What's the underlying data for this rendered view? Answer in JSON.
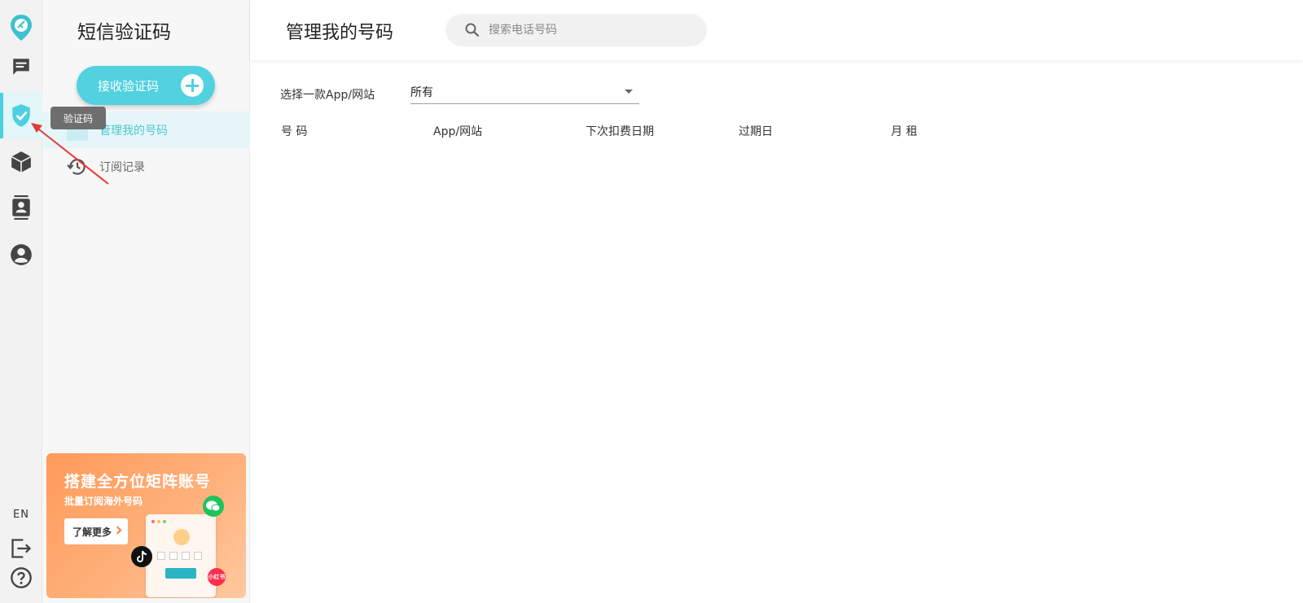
{
  "rail": {
    "items": [
      {
        "name": "logo",
        "icon": "logo-icon"
      },
      {
        "name": "messages",
        "icon": "chat-icon"
      },
      {
        "name": "verify",
        "icon": "shield-check-icon"
      },
      {
        "name": "packages",
        "icon": "box-icon"
      },
      {
        "name": "contacts",
        "icon": "contacts-icon"
      },
      {
        "name": "account",
        "icon": "user-icon"
      }
    ],
    "lang": "EN",
    "tooltip": "验证码",
    "accent": "#4dd0e1"
  },
  "sidebar": {
    "title": "短信验证码",
    "receive_button": "接收验证码",
    "items": [
      {
        "label": "管理我的号码",
        "active": true
      },
      {
        "label": "订阅记录",
        "active": false
      }
    ]
  },
  "promo": {
    "title": "搭建全方位矩阵账号",
    "subtitle": "批量订阅海外号码",
    "button": "了解更多",
    "badge": "小红书"
  },
  "header": {
    "title": "管理我的号码",
    "search_placeholder": "搜索电话号码"
  },
  "filter": {
    "label": "选择一款App/网站",
    "value": "所有"
  },
  "table": {
    "columns": [
      "号 码",
      "App/网站",
      "下次扣费日期",
      "过期日",
      "月 租"
    ]
  }
}
